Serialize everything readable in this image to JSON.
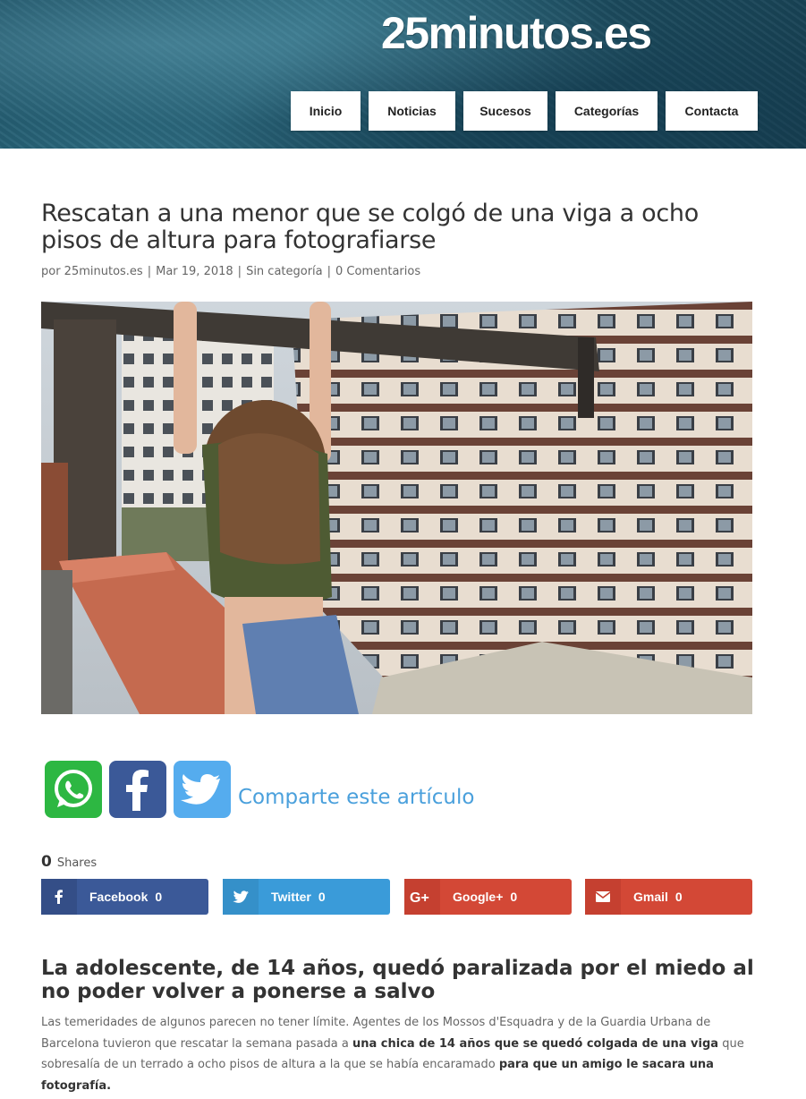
{
  "site": {
    "logo": "25minutos.es"
  },
  "nav": {
    "items": [
      {
        "label": "Inicio"
      },
      {
        "label": "Noticias"
      },
      {
        "label": "Sucesos"
      },
      {
        "label": "Categorías"
      },
      {
        "label": "Contacta"
      }
    ]
  },
  "article": {
    "title": "Rescatan a una menor que se colgó de una viga a ocho pisos de altura para fotografiarse",
    "meta": {
      "author": "por 25minutos.es",
      "date": "Mar 19, 2018",
      "category": "Sin categoría",
      "comments": "0 Comentarios",
      "separator": "|"
    },
    "image_alt": "girl-hanging-from-beam-photo",
    "share_prompt": "Comparte este artículo",
    "shares": {
      "count": "0",
      "label": "Shares",
      "buttons": [
        {
          "label": "Facebook",
          "count": "0",
          "color": "#3b5998"
        },
        {
          "label": "Twitter",
          "count": "0",
          "color": "#3a9bd9"
        },
        {
          "label": "Google+",
          "count": "0",
          "color": "#d34836"
        },
        {
          "label": "Gmail",
          "count": "0",
          "color": "#d34836"
        }
      ]
    },
    "subtitle": "La adolescente, de 14 años, quedó paralizada por el miedo al no poder volver a ponerse a salvo",
    "body": {
      "p1_a": "Las temeridades de algunos parecen no tener límite. Agentes de los Mossos d'Esquadra y de la Guardia Urbana de Barcelona tuvieron que rescatar la semana pasada a ",
      "p1_b": "una chica de 14 años que se quedó colgada de una viga",
      "p1_c": " que sobresalía de un terrado a ocho pisos de altura a la que se había encaramado ",
      "p1_d": "para que un amigo le sacara una fotografía."
    }
  },
  "colors": {
    "header_bg": "#1f5468",
    "link_blue": "#4aa0dc",
    "whatsapp": "#2db742",
    "facebook": "#3b5998",
    "twitter": "#55acee"
  },
  "icons": {
    "whatsapp": "whatsapp-icon",
    "facebook": "facebook-icon",
    "twitter": "twitter-icon",
    "googleplus": "google-plus-icon",
    "gmail": "gmail-envelope-icon"
  }
}
